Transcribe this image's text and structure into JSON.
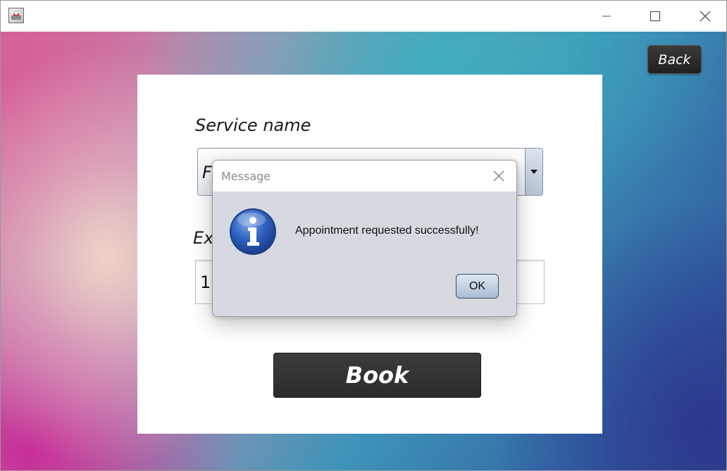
{
  "window": {
    "icon": "java-app-icon",
    "controls": [
      "minimize-icon",
      "maximize-icon",
      "close-icon"
    ]
  },
  "header": {
    "back_label": "Back"
  },
  "form": {
    "service_label": "Service name",
    "service_value": "F",
    "expiry_label": "Exp",
    "expiry_value": "1",
    "book_label": "Book"
  },
  "dialog": {
    "title": "Message",
    "message": "Appointment requested successfully!",
    "ok_label": "OK",
    "icon": "info-icon"
  },
  "colors": {
    "dark_button": "#2b2b2b",
    "dialog_bg": "#d6d9e0",
    "info_blue": "#2a5cb8"
  }
}
